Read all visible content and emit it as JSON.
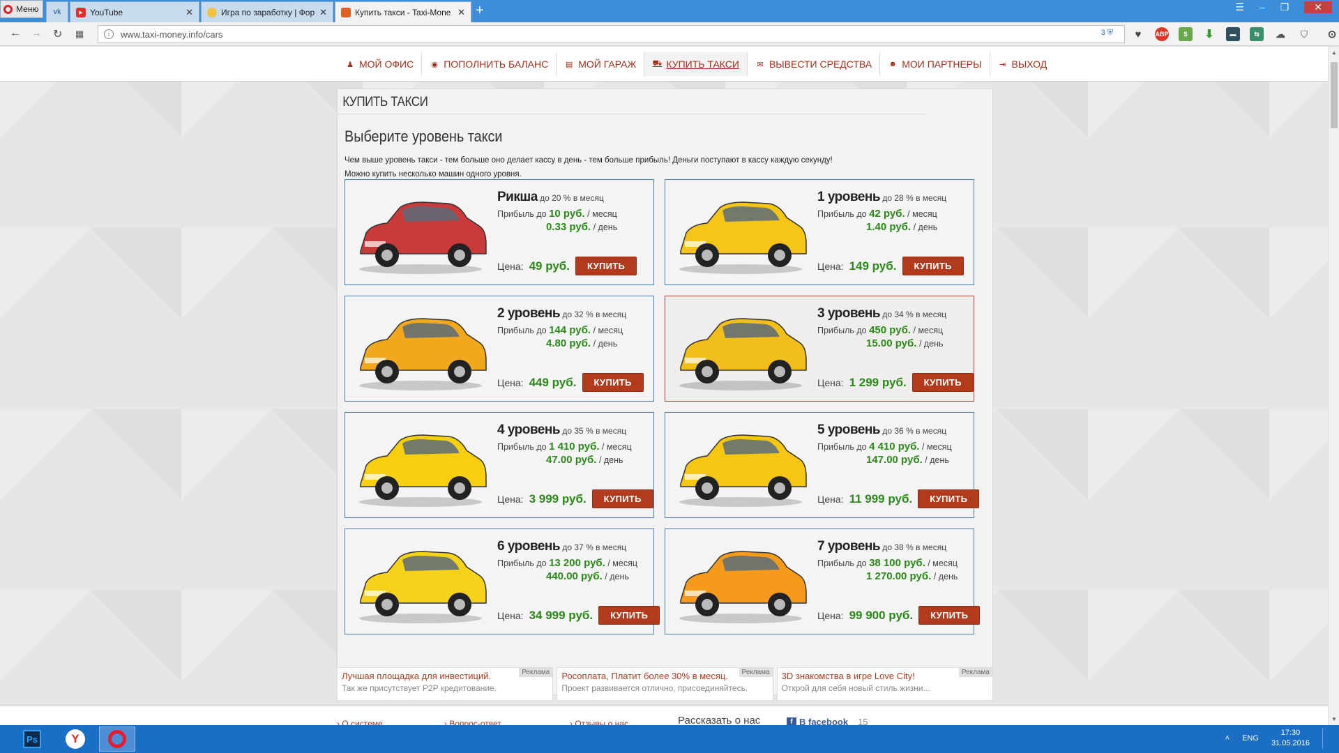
{
  "browser": {
    "menu_label": "Меню",
    "tabs": [
      {
        "title": "",
        "icon": "vk-icon"
      },
      {
        "title": "YouTube",
        "icon": "youtube-icon"
      },
      {
        "title": "Игра по заработку | Фор",
        "icon": "game-icon"
      },
      {
        "title": "Купить такси - Taxi-Mone",
        "icon": "taxi-icon",
        "active": true
      }
    ],
    "new_tab": "+",
    "url": "www.taxi-money.info/cars",
    "shield_count": "3"
  },
  "nav": {
    "items": [
      {
        "label": "МОЙ ОФИС",
        "icon": "office-icon"
      },
      {
        "label": "ПОПОЛНИТЬ БАЛАНС",
        "icon": "coin-icon"
      },
      {
        "label": "МОЙ ГАРАЖ",
        "icon": "garage-icon"
      },
      {
        "label": "КУПИТЬ ТАКСИ",
        "icon": "car-icon",
        "active": true
      },
      {
        "label": "ВЫВЕСТИ СРЕДСТВА",
        "icon": "cash-icon"
      },
      {
        "label": "МОИ ПАРТНЕРЫ",
        "icon": "partners-icon"
      },
      {
        "label": "ВЫХОД",
        "icon": "exit-icon"
      }
    ]
  },
  "page": {
    "header": "КУПИТЬ ТАКСИ",
    "title": "Выберите уровень такси",
    "desc1": "Чем выше уровень такси - тем больше оно делает кассу в день - тем больше прибыль! Деньги поступают в кассу каждую секунду!",
    "desc2": "Можно купить несколько машин одного уровня."
  },
  "labels": {
    "per_month": "в месяц",
    "profit_prefix": "Прибыль до",
    "per_month_short": "/ месяц",
    "per_day": "/ день",
    "price": "Цена:",
    "buy": "КУПИТЬ"
  },
  "cards": [
    {
      "name": "Рикша",
      "rate": "до 20 %",
      "profit_month": "10 руб.",
      "profit_day": "0.33 руб.",
      "price": "49 руб.",
      "car_color": "#c93a3a"
    },
    {
      "name": "1 уровень",
      "rate": "до 28 %",
      "profit_month": "42 руб.",
      "profit_day": "1.40 руб.",
      "price": "149 руб.",
      "car_color": "#f5c518"
    },
    {
      "name": "2 уровень",
      "rate": "до 32 %",
      "profit_month": "144 руб.",
      "profit_day": "4.80 руб.",
      "price": "449 руб.",
      "car_color": "#f2a81c"
    },
    {
      "name": "3 уровень",
      "rate": "до 34 %",
      "profit_month": "450 руб.",
      "profit_day": "15.00 руб.",
      "price": "1 299 руб.",
      "car_color": "#f2be1a"
    },
    {
      "name": "4 уровень",
      "rate": "до 35 %",
      "profit_month": "1 410 руб.",
      "profit_day": "47.00 руб.",
      "price": "3 999 руб.",
      "car_color": "#f5cf10"
    },
    {
      "name": "5 уровень",
      "rate": "до 36 %",
      "profit_month": "4 410 руб.",
      "profit_day": "147.00 руб.",
      "price": "11 999 руб.",
      "car_color": "#f5c712"
    },
    {
      "name": "6 уровень",
      "rate": "до 37 %",
      "profit_month": "13 200 руб.",
      "profit_day": "440.00 руб.",
      "price": "34 999 руб.",
      "car_color": "#f6d21a"
    },
    {
      "name": "7 уровень",
      "rate": "до 38 %",
      "profit_month": "38 100 руб.",
      "profit_day": "1 270.00 руб.",
      "price": "99 900 руб.",
      "car_color": "#f59a1a"
    }
  ],
  "ads": [
    {
      "title": "Лучшая площадка для инвестиций.",
      "text": "Так же присутствует P2P кредитование.",
      "tag": "Реклама"
    },
    {
      "title": "Росоплата, Платит более 30% в месяц.",
      "text": "Проект развивается отлично, присоединяйтесь.",
      "tag": "Реклама"
    },
    {
      "title": "3D знакомства в игре Love City!",
      "text": "Открой для себя новый стиль жизни...",
      "tag": "Реклама"
    }
  ],
  "footer": {
    "links": [
      "О системе",
      "Вопрос-ответ",
      "Отзывы о нас"
    ],
    "share": "Рассказать о нас",
    "facebook": "В facebook",
    "fb_count": "15"
  },
  "taskbar": {
    "lang": "ENG",
    "time": "17:30",
    "date": "31.05.2016"
  }
}
